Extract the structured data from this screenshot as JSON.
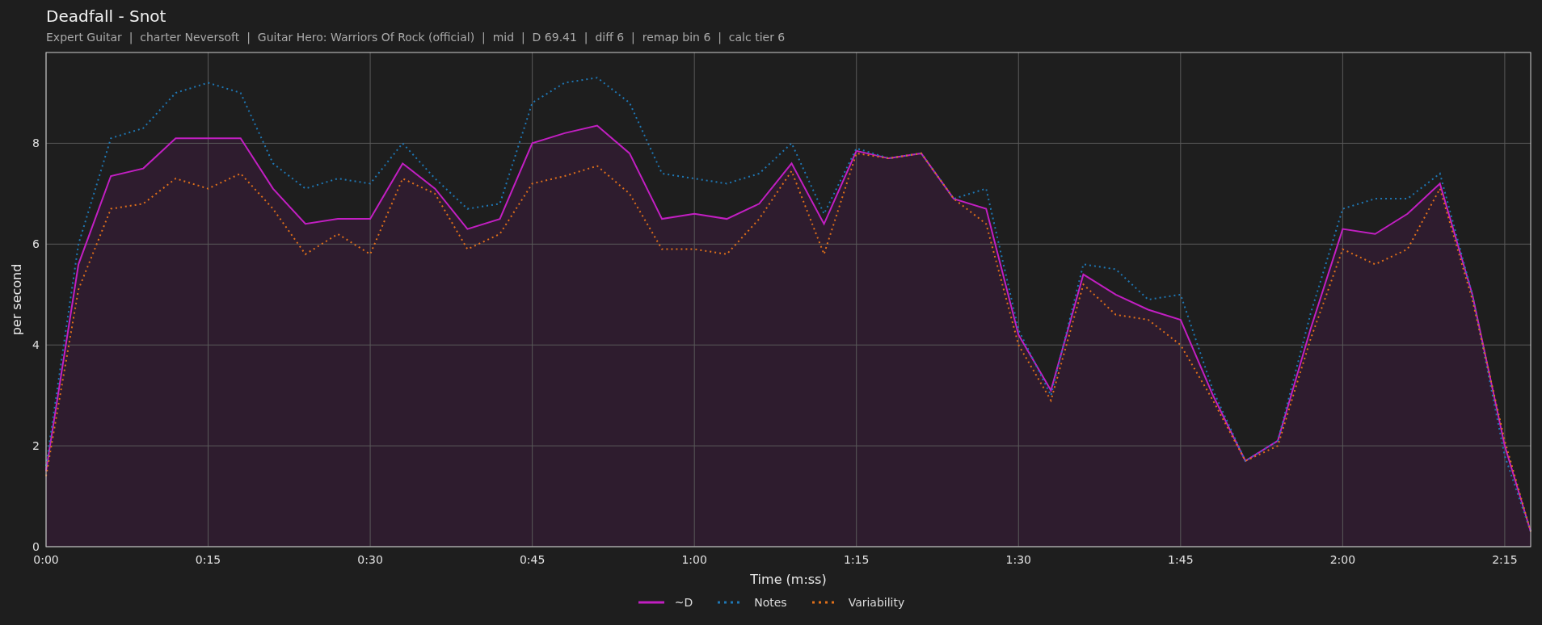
{
  "chart": {
    "subtitle": "Expert Guitar  |  charter Neversoft  |  Guitar Hero: Warriors Of Rock (official)  |  mid  |  D 69.41  |  diff 6  |  remap bin 6  |  calc tier 6",
    "chart_data": {
      "type": "line",
      "grid": true,
      "title": "Deadfall - Snot",
      "xlabel": "Time (m:ss)",
      "ylabel": "per second",
      "x": [
        0,
        3,
        6,
        9,
        12,
        15,
        18,
        21,
        24,
        27,
        30,
        33,
        36,
        39,
        42,
        45,
        48,
        51,
        54,
        57,
        60,
        63,
        66,
        69,
        72,
        75,
        78,
        81,
        84,
        87,
        90,
        93,
        96,
        99,
        102,
        105,
        108,
        111,
        114,
        117,
        120,
        123,
        126,
        129,
        132,
        135,
        137.4
      ],
      "series": [
        {
          "name": "~D",
          "color": "#c21fc2",
          "line_style": "solid",
          "type": "area",
          "values": [
            1.5,
            5.6,
            7.35,
            7.5,
            8.1,
            8.1,
            8.1,
            7.1,
            6.4,
            6.5,
            6.5,
            7.6,
            7.1,
            6.3,
            6.5,
            8.0,
            8.2,
            8.35,
            7.8,
            6.5,
            6.6,
            6.5,
            6.8,
            7.6,
            6.4,
            7.85,
            7.7,
            7.8,
            6.9,
            6.7,
            4.2,
            3.1,
            5.4,
            5.0,
            4.7,
            4.5,
            3.0,
            1.7,
            2.1,
            4.3,
            6.3,
            6.2,
            6.6,
            7.2,
            5.0,
            2.0,
            0.3
          ]
        },
        {
          "name": "Notes",
          "color": "#1f77b4",
          "line_style": "dotted",
          "type": "line",
          "values": [
            1.6,
            6.0,
            8.1,
            8.3,
            9.0,
            9.2,
            9.0,
            7.6,
            7.1,
            7.3,
            7.2,
            8.0,
            7.3,
            6.7,
            6.8,
            8.8,
            9.2,
            9.3,
            8.8,
            7.4,
            7.3,
            7.2,
            7.4,
            8.0,
            6.6,
            7.9,
            7.7,
            7.8,
            6.9,
            7.1,
            4.3,
            3.0,
            5.6,
            5.5,
            4.9,
            5.0,
            3.1,
            1.7,
            2.1,
            4.6,
            6.7,
            6.9,
            6.9,
            7.4,
            5.0,
            1.8,
            0.3
          ]
        },
        {
          "name": "Variability",
          "color": "#e0701a",
          "line_style": "dotted",
          "type": "line",
          "values": [
            1.4,
            5.1,
            6.7,
            6.8,
            7.3,
            7.1,
            7.4,
            6.7,
            5.8,
            6.2,
            5.8,
            7.3,
            7.0,
            5.9,
            6.2,
            7.2,
            7.35,
            7.55,
            7.0,
            5.9,
            5.9,
            5.8,
            6.5,
            7.45,
            5.8,
            7.8,
            7.7,
            7.8,
            6.9,
            6.4,
            4.0,
            2.9,
            5.2,
            4.6,
            4.5,
            4.0,
            2.9,
            1.7,
            2.0,
            4.1,
            5.9,
            5.6,
            5.9,
            7.1,
            4.9,
            2.1,
            0.3
          ]
        }
      ],
      "xlim": [
        0,
        137.4
      ],
      "ylim": [
        0,
        9.8
      ],
      "xticks": [
        {
          "value": 0,
          "label": "0:00"
        },
        {
          "value": 15,
          "label": "0:15"
        },
        {
          "value": 30,
          "label": "0:30"
        },
        {
          "value": 45,
          "label": "0:45"
        },
        {
          "value": 60,
          "label": "1:00"
        },
        {
          "value": 75,
          "label": "1:15"
        },
        {
          "value": 90,
          "label": "1:30"
        },
        {
          "value": 105,
          "label": "1:45"
        },
        {
          "value": 120,
          "label": "2:00"
        },
        {
          "value": 135,
          "label": "2:15"
        }
      ],
      "yticks": [
        0,
        2,
        4,
        6,
        8
      ]
    }
  }
}
